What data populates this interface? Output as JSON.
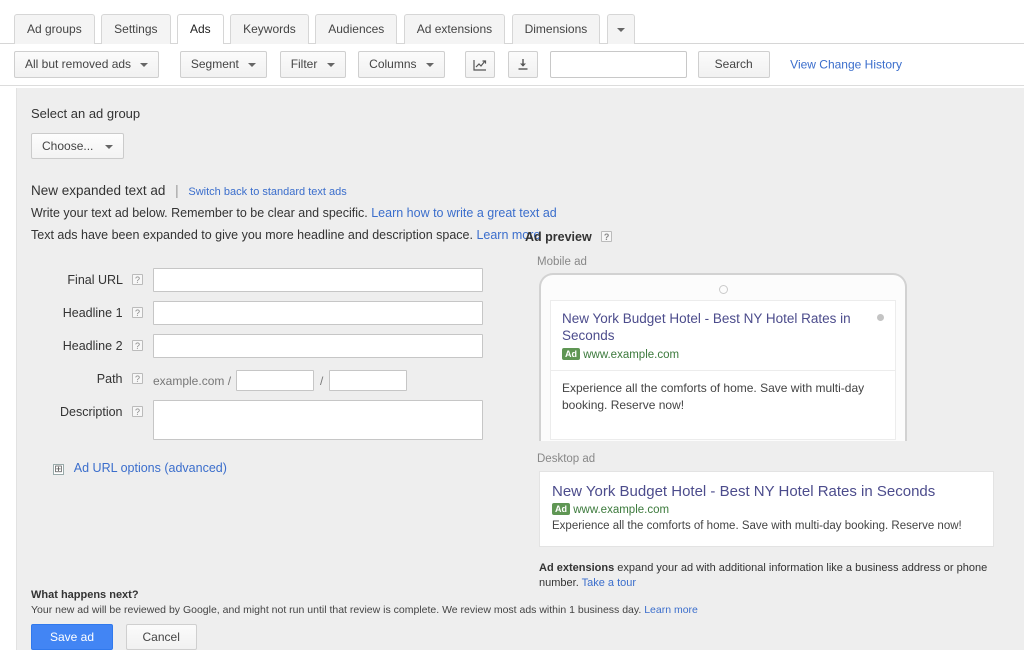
{
  "tabs": [
    {
      "label": "Ad groups",
      "active": false
    },
    {
      "label": "Settings",
      "active": false
    },
    {
      "label": "Ads",
      "active": true
    },
    {
      "label": "Keywords",
      "active": false
    },
    {
      "label": "Audiences",
      "active": false
    },
    {
      "label": "Ad extensions",
      "active": false
    },
    {
      "label": "Dimensions",
      "active": false
    }
  ],
  "toolbar": {
    "filter_view_label": "All but removed ads",
    "segment_label": "Segment",
    "filter_label": "Filter",
    "columns_label": "Columns",
    "chart_icon": "line-chart-icon",
    "download_icon": "download-icon",
    "search_value": "",
    "search_placeholder": "",
    "search_button_label": "Search",
    "change_history_link": "View Change History"
  },
  "adgroup": {
    "section_label": "Select an ad group",
    "choose_label": "Choose..."
  },
  "intro": {
    "heading": "New expanded text ad",
    "separator": "|",
    "switch_link": "Switch back to standard text ads",
    "line1_text": "Write your text ad below. Remember to be clear and specific.",
    "line1_link": "Learn how to write a great text ad",
    "line2_text": "Text ads have been expanded to give you more headline and description space.",
    "line2_link": "Learn more"
  },
  "form": {
    "help_glyph": "?",
    "fields": {
      "final_url": {
        "label": "Final URL",
        "value": "",
        "placeholder": ""
      },
      "headline1": {
        "label": "Headline 1",
        "value": "",
        "placeholder": ""
      },
      "headline2": {
        "label": "Headline 2",
        "value": "",
        "placeholder": ""
      },
      "path": {
        "label": "Path",
        "domain": "example.com /",
        "slash": "/",
        "value1": "",
        "value2": ""
      },
      "description": {
        "label": "Description",
        "value": "",
        "placeholder": ""
      }
    },
    "url_options": {
      "expand_glyph": "⊞",
      "label": "Ad URL options (advanced)"
    }
  },
  "preview": {
    "title": "Ad preview",
    "help_glyph": "?",
    "mobile_label": "Mobile ad",
    "desktop_label": "Desktop ad",
    "ad_badge": "Ad",
    "mobile": {
      "headline": "New York Budget Hotel - Best NY Hotel Rates in Seconds",
      "url": "www.example.com",
      "description": "Experience all the comforts of home. Save with multi-day booking. Reserve now!"
    },
    "desktop": {
      "headline": "New York Budget Hotel - Best NY Hotel Rates in Seconds",
      "url": "www.example.com",
      "description": "Experience all the comforts of home. Save with multi-day booking. Reserve now!"
    },
    "extensions_note": {
      "bold": "Ad extensions",
      "text": " expand your ad with additional information like a business address or phone number. ",
      "link": "Take a tour"
    }
  },
  "footer": {
    "title": "What happens next?",
    "text": "Your new ad will be reviewed by Google, and might not run until that review is complete. We review most ads within 1 business day. ",
    "link": "Learn more",
    "save_label": "Save ad",
    "cancel_label": "Cancel"
  },
  "colors": {
    "accent_blue": "#3b6ecc",
    "primary_button": "#4285f4",
    "ad_badge_green": "#5f9654",
    "url_green": "#3c7a3c",
    "headline_purple": "#4c4c8c",
    "panel_bg": "#eeeeee"
  }
}
